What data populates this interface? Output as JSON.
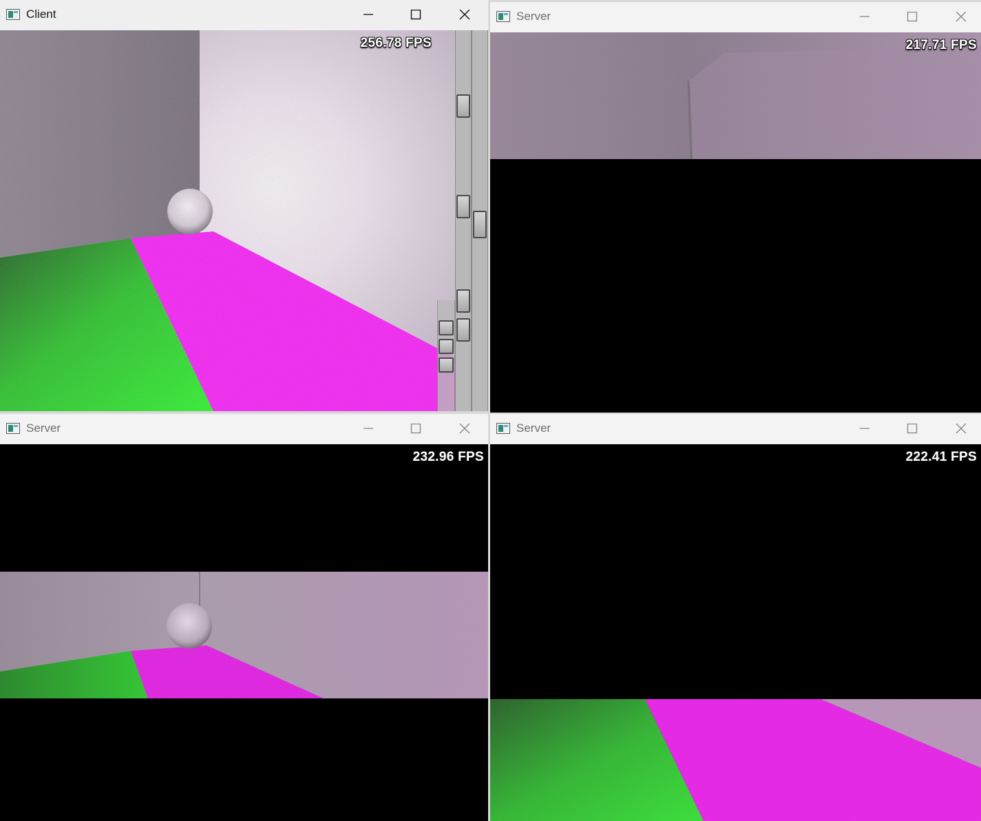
{
  "windows": [
    {
      "id": "client",
      "title": "Client",
      "fps": "256.78 FPS",
      "active": true
    },
    {
      "id": "server-1",
      "title": "Server",
      "fps": "217.71 FPS",
      "active": false
    },
    {
      "id": "server-2",
      "title": "Server",
      "fps": "232.96 FPS",
      "active": false
    },
    {
      "id": "server-3",
      "title": "Server",
      "fps": "222.41 FPS",
      "active": false
    }
  ],
  "scene_colors": {
    "floor_green": "#13ff13",
    "floor_magenta": "#ff10ff",
    "wall_light": "#e8e2ea",
    "wall_gray": "#8e8a90",
    "background_black": "#000000"
  },
  "icons": {
    "minimize": "minimize-icon",
    "maximize": "maximize-icon",
    "close": "close-icon",
    "app": "app-window-icon"
  }
}
